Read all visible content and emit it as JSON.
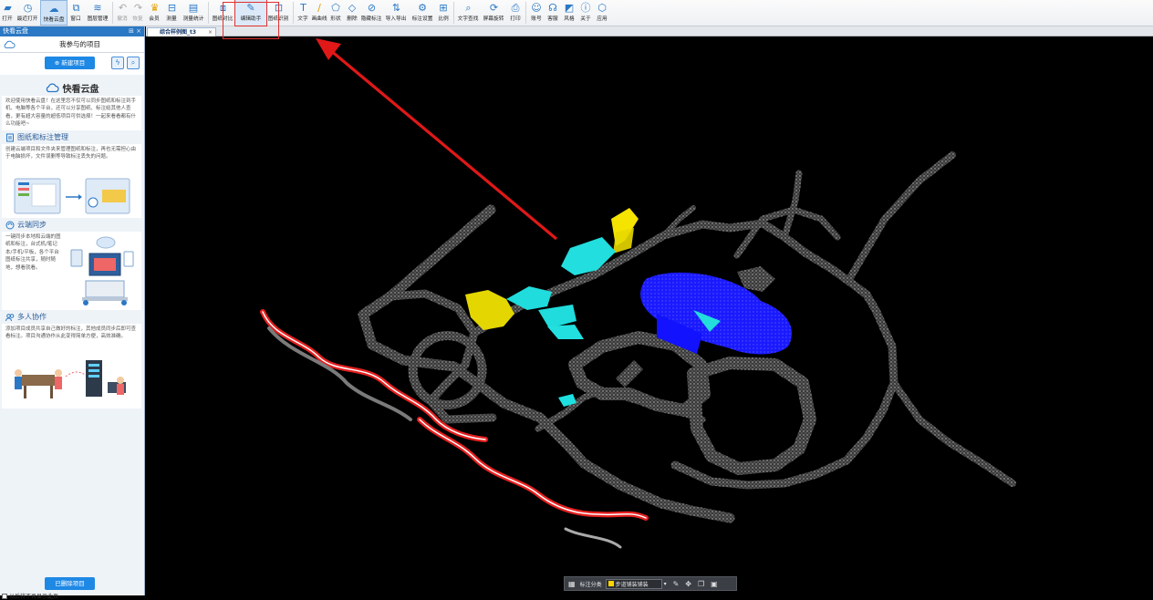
{
  "toolbar": {
    "items": [
      {
        "label": "打开",
        "icon": "folder-icon",
        "enabled": true
      },
      {
        "label": "最近打开",
        "icon": "history-icon",
        "enabled": true
      },
      {
        "label": "快看云盘",
        "icon": "cloud-icon",
        "enabled": true,
        "active": true
      },
      {
        "label": "窗口",
        "icon": "window-icon",
        "enabled": true
      },
      {
        "label": "图层管理",
        "icon": "layers-icon",
        "enabled": true
      },
      {
        "label": "撤消",
        "icon": "undo-icon",
        "enabled": false
      },
      {
        "label": "恢复",
        "icon": "redo-icon",
        "enabled": false
      },
      {
        "label": "会员",
        "icon": "vip-icon",
        "enabled": true
      },
      {
        "label": "测量",
        "icon": "ruler-icon",
        "enabled": true
      },
      {
        "label": "测量统计",
        "icon": "measure-stats-icon",
        "enabled": true
      },
      {
        "label": "图纸对比",
        "icon": "compare-icon",
        "enabled": true
      },
      {
        "label": "编辑助手",
        "icon": "edit-assistant-icon",
        "enabled": true,
        "highlighted": true
      },
      {
        "label": "图纸识别",
        "icon": "recognize-icon",
        "enabled": true
      },
      {
        "label": "文字",
        "icon": "text-icon",
        "enabled": true
      },
      {
        "label": "画曲线",
        "icon": "curve-icon",
        "enabled": true
      },
      {
        "label": "形状",
        "icon": "shape-icon",
        "enabled": true
      },
      {
        "label": "删除",
        "icon": "eraser-icon",
        "enabled": true
      },
      {
        "label": "隐藏标注",
        "icon": "hide-icon",
        "enabled": true
      },
      {
        "label": "导入导出",
        "icon": "import-export-icon",
        "enabled": true
      },
      {
        "label": "标注设置",
        "icon": "annotation-settings-icon",
        "enabled": true
      },
      {
        "label": "比例",
        "icon": "scale-icon",
        "enabled": true
      },
      {
        "label": "文字查找",
        "icon": "text-search-icon",
        "enabled": true
      },
      {
        "label": "屏幕旋转",
        "icon": "rotate-icon",
        "enabled": true
      },
      {
        "label": "打印",
        "icon": "print-icon",
        "enabled": true
      },
      {
        "label": "账号",
        "icon": "account-icon",
        "enabled": true
      },
      {
        "label": "客服",
        "icon": "headset-icon",
        "enabled": true
      },
      {
        "label": "风格",
        "icon": "style-icon",
        "enabled": true
      },
      {
        "label": "关于",
        "icon": "info-icon",
        "enabled": true
      },
      {
        "label": "应用",
        "icon": "apps-icon",
        "enabled": true
      }
    ]
  },
  "tabs": [
    {
      "label": "综合样例图_t3"
    }
  ],
  "sidebar": {
    "header": "快看云盘",
    "subtitle": "我参与的项目",
    "new_project": "⊕ 新建项目",
    "brand_caption": "快看云盘",
    "intro": "欢迎使用快看云盘！在这里您不仅可以同步图纸和标注到手机、电脑等各个平台，还可以分享图纸、标注给其他人查看，更有超大容量的超低项目可供选择！一起来看看都有什么功能吧~",
    "sections": [
      {
        "title": "图纸和标注管理",
        "text": "创建云端项目和文件夹来管理图纸和标注，再也无需担心由于电脑损坏，文件误删等导致标注丢失的问题。"
      },
      {
        "title": "云端同步",
        "text": "一键同步本地和云端的图纸和标注，台式机/笔记本/手机/平板，各个平台图纸标注共享，随时随地，想看就看。"
      },
      {
        "title": "多人协作",
        "text": "添加项目成员共享自己做好的标注，其他成员同步后即可查看标注。项目沟通协作从此变得简单方便，高效准确。"
      }
    ],
    "deleted_projects": "已删除项目",
    "checkbox_label": "以后将不再显示此页"
  },
  "bottom_bar": {
    "category_label": "标注分类",
    "category_value": "步道铺装铺装",
    "category_color": "#ffd400"
  },
  "colors": {
    "accent": "#1e88e5",
    "highlight_box": "#e03030",
    "arrow": "#e01818"
  }
}
